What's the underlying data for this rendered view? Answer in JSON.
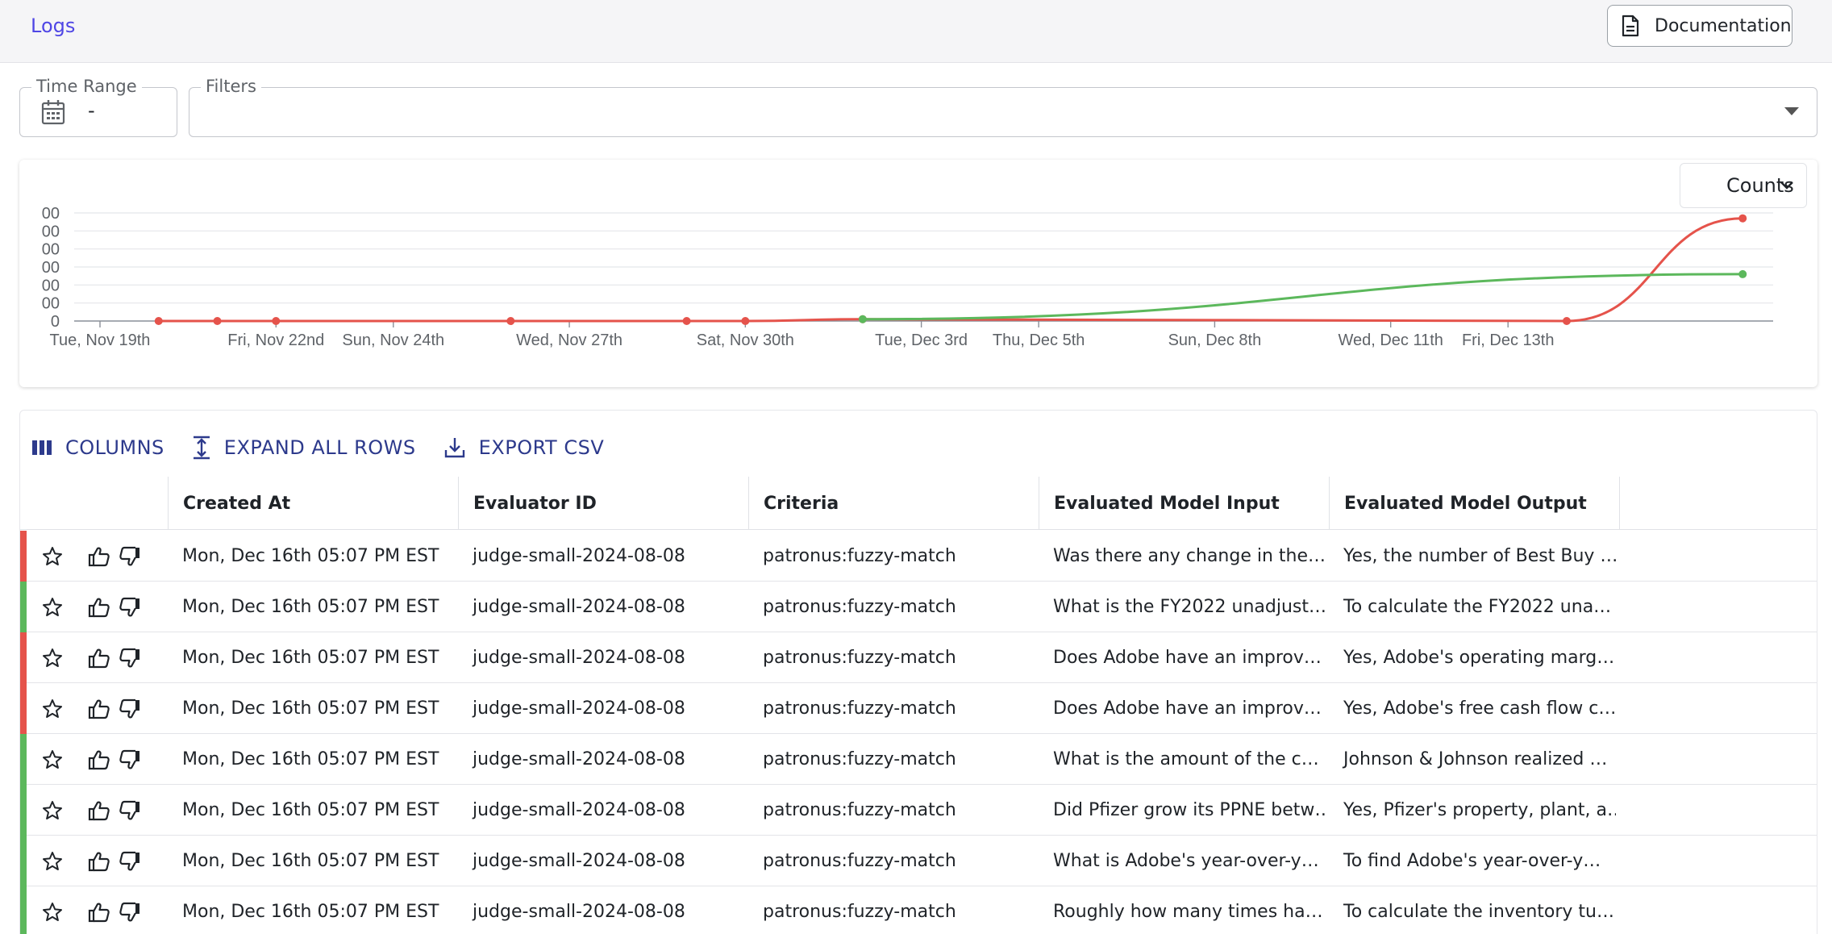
{
  "header": {
    "title": "Logs",
    "documentation_label": "Documentation"
  },
  "filters": {
    "time_range_label": "Time Range",
    "time_range_value": "-",
    "filters_label": "Filters"
  },
  "chart_controls": {
    "metric_select": "Counts"
  },
  "chart_data": {
    "type": "line",
    "x_ticks": [
      "Tue, Nov 19th",
      "Fri, Nov 22nd",
      "Sun, Nov 24th",
      "Wed, Nov 27th",
      "Sat, Nov 30th",
      "Tue, Dec 3rd",
      "Thu, Dec 5th",
      "Sun, Dec 8th",
      "Wed, Dec 11th",
      "Fri, Dec 13th"
    ],
    "y_ticks": [
      "00",
      "00",
      "00",
      "00",
      "00",
      "00",
      "0"
    ],
    "series": [
      {
        "color": "#e5534b",
        "points": [
          [
            "Nov 20",
            0
          ],
          [
            "Nov 21",
            0
          ],
          [
            "Nov 22",
            0
          ],
          [
            "Nov 26",
            0
          ],
          [
            "Nov 29",
            0
          ],
          [
            "Nov 30",
            0
          ],
          [
            "Dec 2",
            1
          ],
          [
            "Dec 14",
            0
          ],
          [
            "Dec 17",
            57
          ]
        ]
      },
      {
        "color": "#5cb85c",
        "points": [
          [
            "Dec 2",
            1
          ],
          [
            "Dec 17",
            26
          ]
        ]
      }
    ],
    "ylim": [
      0,
      60
    ],
    "grid": true,
    "legend": "none"
  },
  "toolbar": {
    "columns_label": "COLUMNS",
    "expand_label": "EXPAND ALL ROWS",
    "export_label": "EXPORT CSV"
  },
  "table": {
    "headers": [
      "Created At",
      "Evaluator ID",
      "Criteria",
      "Evaluated Model Input",
      "Evaluated Model Output"
    ],
    "rows": [
      {
        "status_color": "#e5534b",
        "created_at": "Mon, Dec 16th 05:07 PM EST",
        "evaluator_id": "judge-small-2024-08-08",
        "criteria": "patronus:fuzzy-match",
        "input": "Was there any change in the…",
        "output": "Yes, the number of Best Buy …"
      },
      {
        "status_color": "#5cb85c",
        "created_at": "Mon, Dec 16th 05:07 PM EST",
        "evaluator_id": "judge-small-2024-08-08",
        "criteria": "patronus:fuzzy-match",
        "input": "What is the FY2022 unadjust…",
        "output": "To calculate the FY2022 una…"
      },
      {
        "status_color": "#e5534b",
        "created_at": "Mon, Dec 16th 05:07 PM EST",
        "evaluator_id": "judge-small-2024-08-08",
        "criteria": "patronus:fuzzy-match",
        "input": "Does Adobe have an improv…",
        "output": "Yes, Adobe's operating marg…"
      },
      {
        "status_color": "#e5534b",
        "created_at": "Mon, Dec 16th 05:07 PM EST",
        "evaluator_id": "judge-small-2024-08-08",
        "criteria": "patronus:fuzzy-match",
        "input": "Does Adobe have an improv…",
        "output": "Yes, Adobe's free cash flow c…"
      },
      {
        "status_color": "#5cb85c",
        "created_at": "Mon, Dec 16th 05:07 PM EST",
        "evaluator_id": "judge-small-2024-08-08",
        "criteria": "patronus:fuzzy-match",
        "input": "What is the amount of the c…",
        "output": "Johnson & Johnson realized …"
      },
      {
        "status_color": "#5cb85c",
        "created_at": "Mon, Dec 16th 05:07 PM EST",
        "evaluator_id": "judge-small-2024-08-08",
        "criteria": "patronus:fuzzy-match",
        "input": "Did Pfizer grow its PPNE betw…",
        "output": "Yes, Pfizer's property, plant, a…"
      },
      {
        "status_color": "#5cb85c",
        "created_at": "Mon, Dec 16th 05:07 PM EST",
        "evaluator_id": "judge-small-2024-08-08",
        "criteria": "patronus:fuzzy-match",
        "input": "What is Adobe's year-over-y…",
        "output": "To find Adobe's year-over-y…"
      },
      {
        "status_color": "#5cb85c",
        "created_at": "Mon, Dec 16th 05:07 PM EST",
        "evaluator_id": "judge-small-2024-08-08",
        "criteria": "patronus:fuzzy-match",
        "input": "Roughly how many times ha…",
        "output": "To calculate the inventory tu…"
      }
    ]
  }
}
